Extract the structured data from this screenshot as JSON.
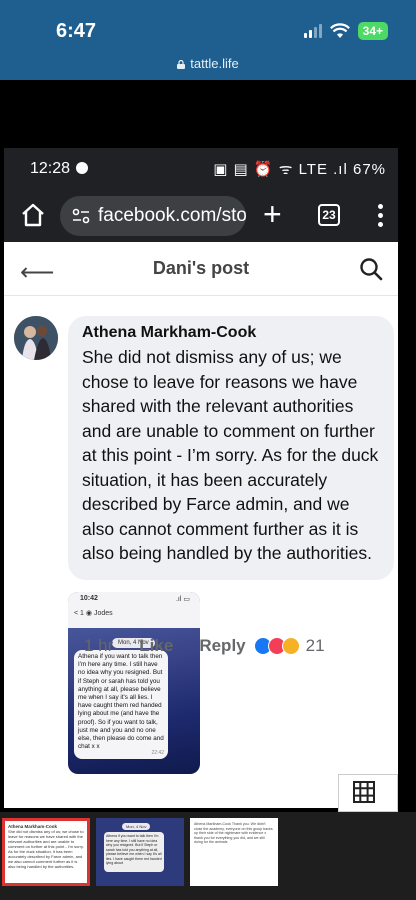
{
  "ios": {
    "time": "6:47",
    "battery": "34+",
    "url": "tattle.life"
  },
  "android": {
    "time": "12:28",
    "status_right": "▣ ▤ ⏰ ᯤ LTE .ıl 67%"
  },
  "browser": {
    "url": "facebook.com/sto",
    "tab_count": "23"
  },
  "post_header": {
    "title": "Dani's post"
  },
  "comment": {
    "author": "Athena Markham-Cook",
    "text": "She did not dismiss any of us; we chose to leave for reasons we have shared with the relevant authorities and are unable to comment on further at this point - I’m sorry. As for the duck situation, it has been accurately described by Farce admin, and we also cannot comment further as it is also being handled by the authorities.",
    "age": "1 hr",
    "like_label": "Like",
    "reply_label": "Reply",
    "reaction_count": "21"
  },
  "attached_screenshot": {
    "time": "10:42",
    "contact": "Jodes",
    "back_count": "1",
    "date": "Mon, 4 Nov",
    "message": "Athena if you want to talk then I'm here any time. I still have no idea why you resigned. But if Steph or sarah has told you anything at all, please believe me when I say it's all lies. I have caught them red handed lying about me (and have the proof). So if you want to talk, just me and you and no one else, then please do come and chat x x",
    "stamp": "22:42"
  },
  "strip": {
    "thumb1_author": "Athena Markham-Cook",
    "thumb1_text": "She did not dismiss any of us; we chose to leave for reasons we have shared with the relevant authorities and are unable to comment on further at this point - I'm sorry. As for the duck situation, it has been accurately described by Farce admin, and we also cannot comment further as it is also being handled by the authorities.",
    "thumb2_date": "Mon, 4 Nov",
    "thumb2_text": "Athena if you want to talk then I'm here any time. I still have no idea why you resigned. But if Steph or sarah has told you anything at all, please believe me when I say it's all lies. I have caught them red handed lying about",
    "thumb3_text": "Athena Markham-Cook Thank you. We didn't close the academy, everyone on this group backs up their side of the nightmare with evidence x thank you for everything you did, and we still doing for the animals"
  },
  "colors": {
    "ios_bar": "#1f5f8f",
    "chrome_bar": "#202124",
    "bubble": "#eef0f3",
    "strip": "#1e1e1e"
  }
}
